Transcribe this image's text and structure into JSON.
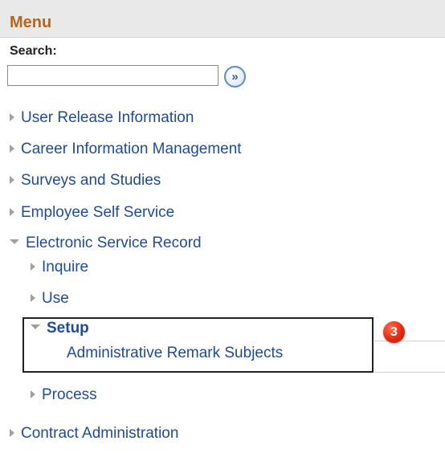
{
  "menu": {
    "title": "Menu"
  },
  "search": {
    "label": "Search:",
    "value": "",
    "placeholder": "",
    "go_icon": "»"
  },
  "nav": {
    "items": [
      {
        "label": "User Release Information",
        "state": "collapsed"
      },
      {
        "label": "Career Information Management",
        "state": "collapsed"
      },
      {
        "label": "Surveys and Studies",
        "state": "collapsed"
      },
      {
        "label": "Employee Self Service",
        "state": "collapsed"
      },
      {
        "label": "Electronic Service Record",
        "state": "expanded"
      },
      {
        "label": "Contract Administration",
        "state": "collapsed"
      }
    ],
    "esr_children": [
      {
        "label": "Inquire",
        "state": "collapsed"
      },
      {
        "label": "Use",
        "state": "collapsed"
      },
      {
        "label": "Setup",
        "state": "expanded"
      },
      {
        "label": "Process",
        "state": "collapsed"
      }
    ],
    "setup_children": [
      {
        "label": "Administrative Remark Subjects"
      }
    ]
  },
  "annotation": {
    "step_number": "3"
  },
  "colors": {
    "title": "#b7651d",
    "link": "#1f4b99",
    "badge": "#e22b10"
  }
}
